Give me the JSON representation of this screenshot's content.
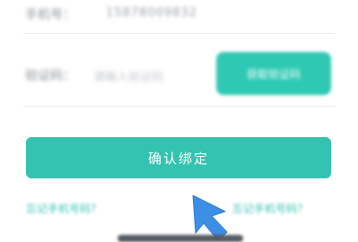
{
  "form": {
    "phone_label": "手机号：",
    "phone_value": "15878009832",
    "code_label": "验证码：",
    "code_placeholder": "请输入验证码",
    "get_code_label": "获取验证码"
  },
  "confirm_label": "确认绑定",
  "links": {
    "left": "忘记手机号码？",
    "right": "忘记手机号码？"
  },
  "colors": {
    "accent": "#33c3b0",
    "cursor": "#3d8fe6"
  },
  "icons": {
    "cursor": "cursor-arrow-icon"
  }
}
